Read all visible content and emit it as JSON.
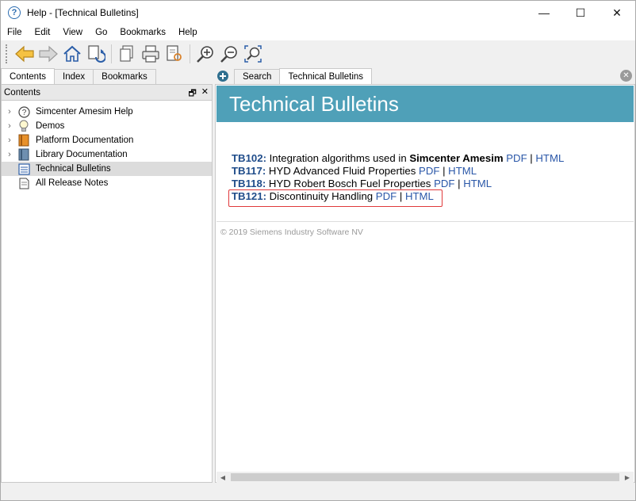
{
  "window": {
    "title": "Help - [Technical Bulletins]",
    "app_icon": "help-question-icon",
    "controls": [
      "—",
      "☐",
      "✕"
    ]
  },
  "menu": [
    "File",
    "Edit",
    "View",
    "Go",
    "Bookmarks",
    "Help"
  ],
  "toolbar": {
    "buttons": [
      "back-icon",
      "forward-icon",
      "home-icon",
      "sync-contents-icon",
      "copy-icon",
      "print-icon",
      "find-in-text-icon",
      "zoom-in-icon",
      "zoom-out-icon",
      "zoom-reset-icon"
    ]
  },
  "left": {
    "tabs": [
      "Contents",
      "Index",
      "Bookmarks"
    ],
    "active_tab": "Contents",
    "pane_title": "Contents",
    "pane_buttons": [
      "🗗",
      "✕"
    ],
    "tree": [
      {
        "label": "Simcenter Amesim Help",
        "expander": "›",
        "icon": "help-icon"
      },
      {
        "label": "Demos",
        "expander": "›",
        "icon": "lightbulb-icon"
      },
      {
        "label": "Platform Documentation",
        "expander": "›",
        "icon": "book-orange-icon"
      },
      {
        "label": "Library Documentation",
        "expander": "›",
        "icon": "book-blue-icon"
      },
      {
        "label": "Technical Bulletins",
        "expander": "",
        "icon": "document-list-icon",
        "selected": true
      },
      {
        "label": "All Release Notes",
        "expander": "",
        "icon": "document-icon"
      }
    ]
  },
  "right": {
    "tabs": [
      "Search",
      "Technical Bulletins"
    ],
    "active_tab": "Technical Bulletins",
    "close_glyph": "✕",
    "page_title": "Technical Bulletins",
    "bulletins": [
      {
        "code": "TB102:",
        "text": " Integration algorithms used in ",
        "strong": "Simcenter Amesim",
        "pdf": "PDF",
        "sep": " | ",
        "html": "HTML"
      },
      {
        "code": "TB117:",
        "text": " HYD Advanced Fluid Properties ",
        "strong": "",
        "pdf": "PDF",
        "sep": " | ",
        "html": "HTML"
      },
      {
        "code": "TB118:",
        "text": " HYD Robert Bosch Fuel Properties ",
        "strong": "",
        "pdf": "PDF",
        "sep": " | ",
        "html": "HTML"
      },
      {
        "code": "TB121:",
        "text": " Discontinuity Handling ",
        "strong": "",
        "pdf": "PDF",
        "sep": " | ",
        "html": "HTML"
      }
    ],
    "copyright": "© 2019 Siemens Industry Software NV"
  },
  "colors": {
    "banner": "#4fa0b8",
    "link": "#2a57a8",
    "code": "#1f4c8a",
    "highlight": "#e0393b"
  }
}
